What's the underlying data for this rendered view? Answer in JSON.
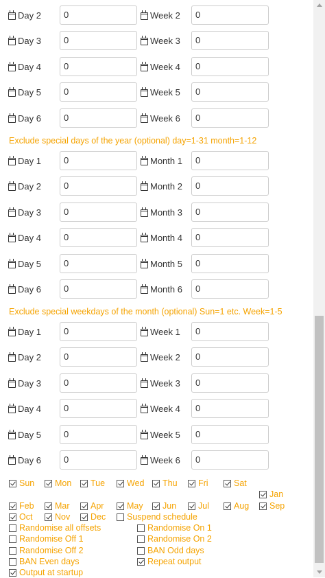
{
  "block1": [
    {
      "l1": "Day 2",
      "v1": "0",
      "l2": "Week 2",
      "v2": "0"
    },
    {
      "l1": "Day 3",
      "v1": "0",
      "l2": "Week 3",
      "v2": "0"
    },
    {
      "l1": "Day 4",
      "v1": "0",
      "l2": "Week 4",
      "v2": "0"
    },
    {
      "l1": "Day 5",
      "v1": "0",
      "l2": "Week 5",
      "v2": "0"
    },
    {
      "l1": "Day 6",
      "v1": "0",
      "l2": "Week 6",
      "v2": "0"
    }
  ],
  "section_year": "Exclude special days of the year (optional) day=1-31 month=1-12",
  "block2": [
    {
      "l1": "Day 1",
      "v1": "0",
      "l2": "Month 1",
      "v2": "0"
    },
    {
      "l1": "Day 2",
      "v1": "0",
      "l2": "Month 2",
      "v2": "0"
    },
    {
      "l1": "Day 3",
      "v1": "0",
      "l2": "Month 3",
      "v2": "0"
    },
    {
      "l1": "Day 4",
      "v1": "0",
      "l2": "Month 4",
      "v2": "0"
    },
    {
      "l1": "Day 5",
      "v1": "0",
      "l2": "Month 5",
      "v2": "0"
    },
    {
      "l1": "Day 6",
      "v1": "0",
      "l2": "Month 6",
      "v2": "0"
    }
  ],
  "section_month": "Exclude special weekdays of the month (optional) Sun=1 etc. Week=1-5",
  "block3": [
    {
      "l1": "Day 1",
      "v1": "0",
      "l2": "Week 1",
      "v2": "0"
    },
    {
      "l1": "Day 2",
      "v1": "0",
      "l2": "Week 2",
      "v2": "0"
    },
    {
      "l1": "Day 3",
      "v1": "0",
      "l2": "Week 3",
      "v2": "0"
    },
    {
      "l1": "Day 4",
      "v1": "0",
      "l2": "Week 4",
      "v2": "0"
    },
    {
      "l1": "Day 5",
      "v1": "0",
      "l2": "Week 5",
      "v2": "0"
    },
    {
      "l1": "Day 6",
      "v1": "0",
      "l2": "Week 6",
      "v2": "0"
    }
  ],
  "weekdays": [
    {
      "label": "Sun",
      "checked": true
    },
    {
      "label": "Mon",
      "checked": true
    },
    {
      "label": "Tue",
      "checked": true
    },
    {
      "label": "Wed",
      "checked": true
    },
    {
      "label": "Thu",
      "checked": true
    },
    {
      "label": "Fri",
      "checked": true
    },
    {
      "label": "Sat",
      "checked": true
    },
    {
      "label": "Jan",
      "checked": true
    }
  ],
  "months": [
    {
      "label": "Feb",
      "checked": true
    },
    {
      "label": "Mar",
      "checked": true
    },
    {
      "label": "Apr",
      "checked": true
    },
    {
      "label": "May",
      "checked": true
    },
    {
      "label": "Jun",
      "checked": true
    },
    {
      "label": "Jul",
      "checked": true
    },
    {
      "label": "Aug",
      "checked": true
    },
    {
      "label": "Sep",
      "checked": true
    },
    {
      "label": "Oct",
      "checked": true
    },
    {
      "label": "Nov",
      "checked": true
    },
    {
      "label": "Dec",
      "checked": true
    },
    {
      "label": "Suspend schedule",
      "checked": false
    }
  ],
  "options": [
    {
      "label": "Randomise all offsets",
      "checked": false
    },
    {
      "label": "Randomise On 1",
      "checked": false
    },
    {
      "label": "Randomise Off 1",
      "checked": false
    },
    {
      "label": "Randomise On 2",
      "checked": false
    },
    {
      "label": "Randomise Off 2",
      "checked": false
    },
    {
      "label": "BAN Odd days",
      "checked": false
    },
    {
      "label": "BAN Even days",
      "checked": false
    },
    {
      "label": "Repeat output",
      "checked": true
    },
    {
      "label": "Output at startup",
      "checked": true
    }
  ],
  "colors": {
    "accent": "#f5a300",
    "text": "#333333",
    "border": "#cccccc"
  },
  "icons": {
    "field_icon": "calendar-icon"
  }
}
